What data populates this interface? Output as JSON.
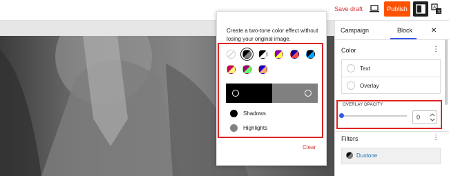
{
  "topbar": {
    "save_draft": "Save draft",
    "publish": "Publish",
    "icons": [
      "desktop-preview-icon",
      "settings-panel-icon",
      "translate-icon"
    ]
  },
  "canvas": {
    "image_description_hidden": null
  },
  "duotone_popover": {
    "description": "Create a two-tone color effect without losing your original image.",
    "presets": [
      {
        "name": "unset",
        "colors": [
          "#ffffff",
          "#ffffff"
        ],
        "selected": false
      },
      {
        "name": "dark-grayscale",
        "colors": [
          "#000000",
          "#808080"
        ],
        "selected": true
      },
      {
        "name": "grayscale",
        "colors": [
          "#000000",
          "#ffffff"
        ],
        "selected": false
      },
      {
        "name": "purple-yellow",
        "colors": [
          "#8c00b7",
          "#fcff41"
        ],
        "selected": false
      },
      {
        "name": "blue-red",
        "colors": [
          "#000097",
          "#ff4747"
        ],
        "selected": false
      },
      {
        "name": "midnight",
        "colors": [
          "#000000",
          "#00a5ff"
        ],
        "selected": false
      },
      {
        "name": "magenta-yellow",
        "colors": [
          "#c7005a",
          "#fff278"
        ],
        "selected": false
      },
      {
        "name": "purple-green",
        "colors": [
          "#a60072",
          "#67ff66"
        ],
        "selected": false
      },
      {
        "name": "blue-orange",
        "colors": [
          "#1900d8",
          "#ffa96b"
        ],
        "selected": false
      }
    ],
    "shadows_color": "#000000",
    "highlights_color": "#808080",
    "shadows_label": "Shadows",
    "highlights_label": "Highlights",
    "clear": "Clear"
  },
  "sidebar": {
    "tabs": [
      "Campaign",
      "Block"
    ],
    "active_tab": "Block",
    "close": "×",
    "color": {
      "title": "Color",
      "rows": [
        "Text",
        "Overlay"
      ]
    },
    "overlay_opacity": {
      "label": "OVERLAY OPACITY",
      "value": "0",
      "slider_fraction": 0
    },
    "filters": {
      "title": "Filters",
      "item": "Duotone"
    },
    "kebab": "⋮"
  },
  "colors": {
    "accent": "#3858e9",
    "publish": "#ff5200",
    "danger": "#d63638",
    "highlight_box": "#e02424"
  }
}
